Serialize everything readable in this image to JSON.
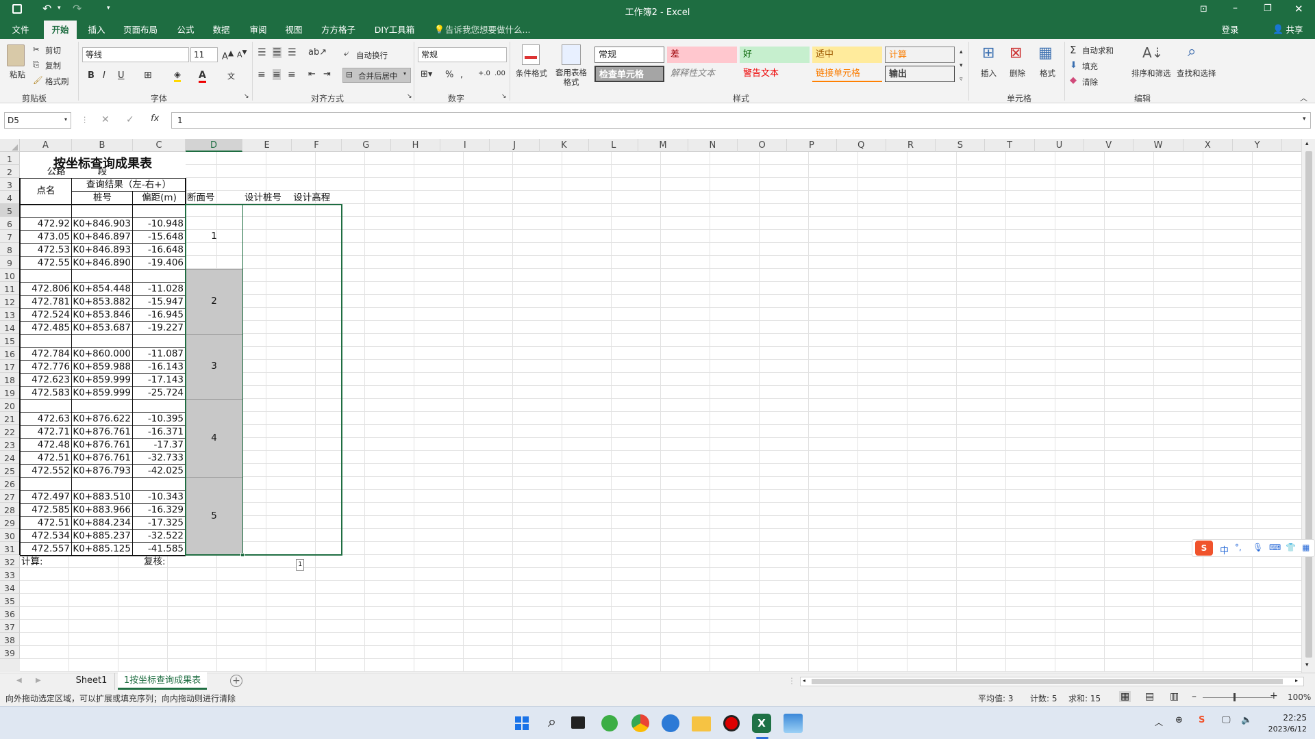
{
  "title": "工作簿2 - Excel",
  "tabs": [
    "文件",
    "开始",
    "插入",
    "页面布局",
    "公式",
    "数据",
    "审阅",
    "视图",
    "方方格子",
    "DIY工具箱"
  ],
  "tell_me": "告诉我您想要做什么...",
  "login": "登录",
  "share": "共享",
  "clipboard": {
    "paste": "粘贴",
    "cut": "剪切",
    "copy": "复制",
    "painter": "格式刷",
    "group": "剪贴板"
  },
  "font": {
    "name": "等线",
    "size": "11",
    "group": "字体"
  },
  "align": {
    "wrap": "自动换行",
    "merge": "合并后居中",
    "group": "对齐方式"
  },
  "number": {
    "format": "常规",
    "group": "数字"
  },
  "styles": {
    "cond": "条件格式",
    "table": "套用表格格式",
    "items": [
      "常规",
      "差",
      "好",
      "适中",
      "计算",
      "检查单元格",
      "解释性文本",
      "警告文本",
      "链接单元格",
      "输出"
    ],
    "group": "样式"
  },
  "cells": {
    "insert": "插入",
    "delete": "删除",
    "format": "格式",
    "group": "单元格"
  },
  "editing": {
    "autosum": "自动求和",
    "fill": "填充",
    "clear": "清除",
    "sort": "排序和筛选",
    "find": "查找和选择",
    "group": "编辑"
  },
  "namebox": "D5",
  "formula": "1",
  "columns": [
    "A",
    "B",
    "C",
    "D",
    "E",
    "F",
    "G",
    "H",
    "I",
    "J",
    "K",
    "L",
    "M",
    "N",
    "O",
    "P",
    "Q",
    "R",
    "S",
    "T",
    "U",
    "V",
    "W",
    "X",
    "Y"
  ],
  "rownums": [
    "1",
    "2",
    "3",
    "4",
    "5",
    "6",
    "7",
    "8",
    "9",
    "10",
    "11",
    "12",
    "13",
    "14",
    "15",
    "16",
    "17",
    "18",
    "19",
    "20",
    "21",
    "22",
    "23",
    "24",
    "25",
    "26",
    "27",
    "28",
    "29",
    "30",
    "31",
    "32",
    "33",
    "34",
    "35",
    "36",
    "37",
    "38",
    "39"
  ],
  "sheet": {
    "title": "按坐标查询成果表",
    "road": "公路",
    "seg": "段",
    "h_point": "点名",
    "h_result": "查询结果（左-右+）",
    "h_pile": "桩号",
    "h_offset": "偏距(m)",
    "h_section": "断面号",
    "h_design_pile": "设计桩号",
    "h_design_elev": "设计高程",
    "rows": [
      [
        "472.92",
        "K0+846.903",
        "-10.948"
      ],
      [
        "473.05",
        "K0+846.897",
        "-15.648"
      ],
      [
        "472.53",
        "K0+846.893",
        "-16.648"
      ],
      [
        "472.55",
        "K0+846.890",
        "-19.406"
      ],
      [
        "472.806",
        "K0+854.448",
        "-11.028"
      ],
      [
        "472.781",
        "K0+853.882",
        "-15.947"
      ],
      [
        "472.524",
        "K0+853.846",
        "-16.945"
      ],
      [
        "472.485",
        "K0+853.687",
        "-19.227"
      ],
      [
        "472.784",
        "K0+860.000",
        "-11.087"
      ],
      [
        "472.776",
        "K0+859.988",
        "-16.143"
      ],
      [
        "472.623",
        "K0+859.999",
        "-17.143"
      ],
      [
        "472.583",
        "K0+859.999",
        "-25.724"
      ],
      [
        "472.63",
        "K0+876.622",
        "-10.395"
      ],
      [
        "472.71",
        "K0+876.761",
        "-16.371"
      ],
      [
        "472.48",
        "K0+876.761",
        "-17.37"
      ],
      [
        "472.51",
        "K0+876.761",
        "-32.733"
      ],
      [
        "472.552",
        "K0+876.793",
        "-42.025"
      ],
      [
        "472.497",
        "K0+883.510",
        "-10.343"
      ],
      [
        "472.585",
        "K0+883.966",
        "-16.329"
      ],
      [
        "472.51",
        "K0+884.234",
        "-17.325"
      ],
      [
        "472.534",
        "K0+885.237",
        "-32.522"
      ],
      [
        "472.557",
        "K0+885.125",
        "-41.585"
      ]
    ],
    "sections": [
      "1",
      "2",
      "3",
      "4",
      "5"
    ],
    "calc": "计算:",
    "review": "复核:",
    "fill_hint": "1"
  },
  "sheettabs": [
    "Sheet1",
    "1按坐标查询成果表"
  ],
  "status": {
    "msg": "向外拖动选定区域，可以扩展或填充序列；向内拖动则进行清除",
    "avg": "平均值: 3",
    "count": "计数: 5",
    "sum": "求和: 15",
    "zoom": "100%"
  },
  "ime": "中",
  "clock": {
    "time": "22:25",
    "date": "2023/6/12"
  }
}
